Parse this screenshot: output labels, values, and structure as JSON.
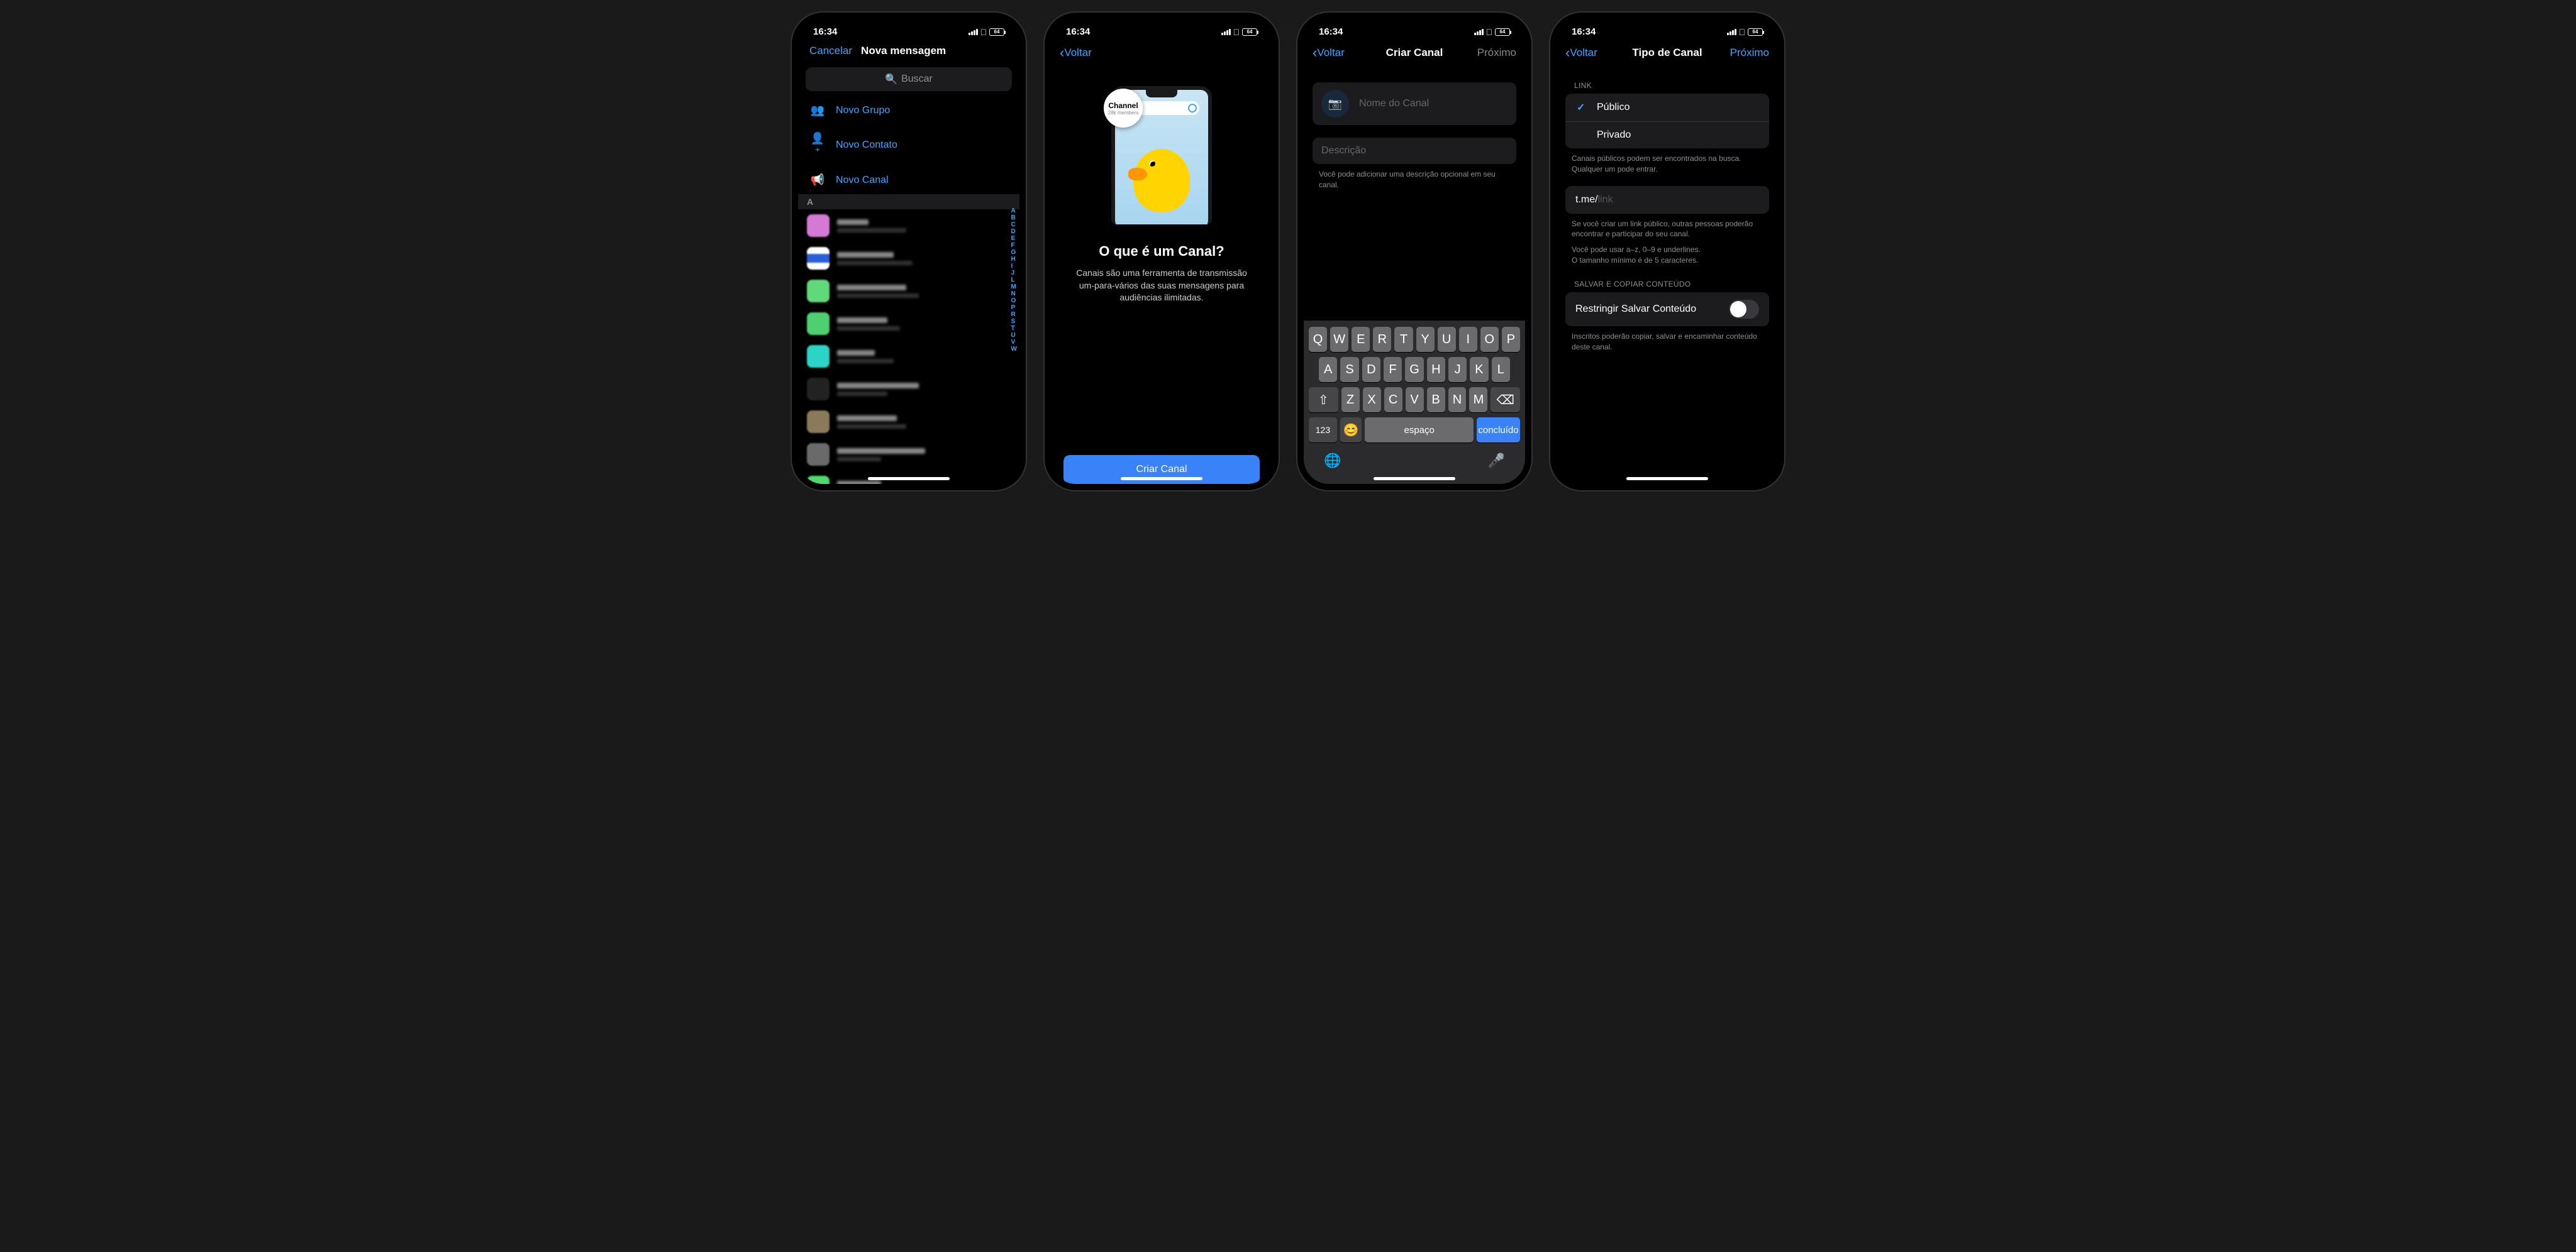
{
  "status": {
    "time": "16:34",
    "battery": "64"
  },
  "s1": {
    "cancel": "Cancelar",
    "title": "Nova mensagem",
    "search_placeholder": "Buscar",
    "menu": {
      "group": "Novo Grupo",
      "contact": "Novo Contato",
      "channel": "Novo Canal"
    },
    "section": "A",
    "index_letters": [
      "A",
      "B",
      "C",
      "D",
      "E",
      "F",
      "G",
      "H",
      "I",
      "J",
      "L",
      "M",
      "N",
      "O",
      "P",
      "R",
      "S",
      "T",
      "U",
      "V",
      "W"
    ]
  },
  "s2": {
    "back": "Voltar",
    "badge_title": "Channel",
    "badge_sub": "28k members",
    "heading": "O que é um Canal?",
    "desc": "Canais são uma ferramenta de transmissão\num-para-vários das suas mensagens para audiências ilimitadas.",
    "cta": "Criar Canal"
  },
  "s3": {
    "back": "Voltar",
    "title": "Criar Canal",
    "next": "Próximo",
    "name_placeholder": "Nome do Canal",
    "desc_placeholder": "Descrição",
    "desc_hint": "Você pode adicionar uma descrição opcional em seu canal.",
    "kb": {
      "r1": [
        "Q",
        "W",
        "E",
        "R",
        "T",
        "Y",
        "U",
        "I",
        "O",
        "P"
      ],
      "r2": [
        "A",
        "S",
        "D",
        "F",
        "G",
        "H",
        "J",
        "K",
        "L"
      ],
      "r3": [
        "Z",
        "X",
        "C",
        "V",
        "B",
        "N",
        "M"
      ],
      "num": "123",
      "space": "espaço",
      "done": "concluído"
    }
  },
  "s4": {
    "back": "Voltar",
    "title": "Tipo de Canal",
    "next": "Próximo",
    "link_header": "LINK",
    "public": "Público",
    "private": "Privado",
    "link_note": "Canais públicos podem ser encontrados na busca. Qualquer um pode entrar.",
    "link_prefix": "t.me/",
    "link_placeholder": "link",
    "link_hint1": "Se você criar um link público, outras pessoas poderão encontrar e participar do seu canal.",
    "link_hint2": "Você pode usar a–z, 0–9 e underlines.\nO tamanho mínimo é de 5 caracteres.",
    "save_header": "SALVAR E COPIAR CONTEÚDO",
    "restrict": "Restringir Salvar Conteúdo",
    "restrict_hint": "Inscritos poderão copiar, salvar e encaminhar conteúdo deste canal."
  }
}
